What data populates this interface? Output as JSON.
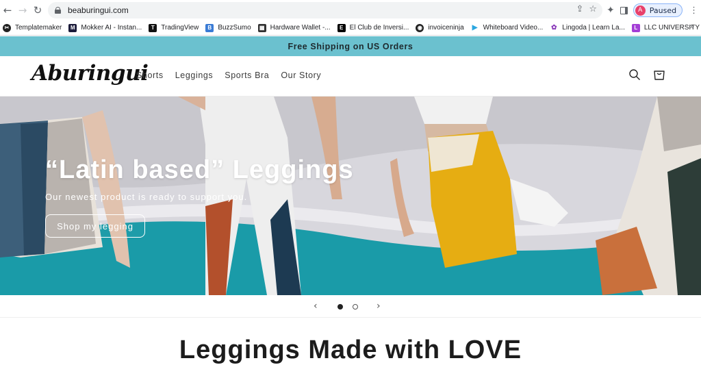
{
  "browser": {
    "url": "beaburingui.com",
    "profile_label": "Paused",
    "profile_initial": "A",
    "bookmarks": [
      {
        "label": "Templatemaker",
        "icon": "scissors-icon"
      },
      {
        "label": "Mokker AI - Instan...",
        "icon": "mokker-icon"
      },
      {
        "label": "TradingView",
        "icon": "tradingview-icon"
      },
      {
        "label": "BuzzSumo",
        "icon": "buzzsumo-icon"
      },
      {
        "label": "Hardware Wallet -...",
        "icon": "ledger-icon"
      },
      {
        "label": "El Club de Inversi...",
        "icon": "club-icon"
      },
      {
        "label": "invoiceninja",
        "icon": "invoiceninja-icon"
      },
      {
        "label": "Whiteboard Video...",
        "icon": "play-icon"
      },
      {
        "label": "Lingoda | Learn La...",
        "icon": "lingoda-icon"
      },
      {
        "label": "LLC UNIVERSITY",
        "icon": "llc-icon"
      }
    ],
    "more_label": "»"
  },
  "announcement": "Free Shipping on US Orders",
  "site": {
    "logo": "Aburingui",
    "menu": [
      "Shorts",
      "Leggings",
      "Sports Bra",
      "Our Story"
    ]
  },
  "hero": {
    "title": "“Latin based” Leggings",
    "subtitle": "Our newest product is ready to support you.",
    "button": "Shop my legging"
  },
  "slider": {
    "prev": "‹",
    "next": "›",
    "slides": 2,
    "active": 1
  },
  "section_title": "Leggings Made with LOVE",
  "colors": {
    "announcement_bg": "#6bc1cf",
    "teal": "#1a9ba8",
    "mustard": "#e6ad12"
  }
}
